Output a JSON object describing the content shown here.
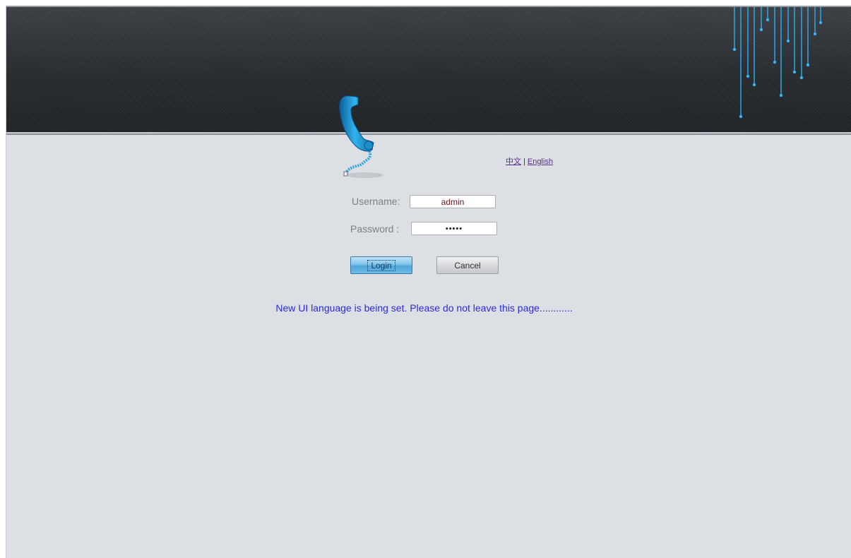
{
  "language_switch": {
    "chinese": "中文",
    "separator": "|",
    "english": "English"
  },
  "login_form": {
    "username_label": "Username:",
    "username_value": "admin",
    "password_label": "Password :",
    "password_value": "•••••",
    "login_button": "Login",
    "cancel_button": "Cancel"
  },
  "status_message": "New UI language is being set. Please do not leave this page............",
  "icons": {
    "logo": "telephone-handset-icon",
    "banner_decoration": "light-lines-decoration"
  },
  "colors": {
    "banner": "#2a2d31",
    "background": "#dcdfe4",
    "accent_blue": "#2a9fd8",
    "status_text": "#2b2bd6",
    "link": "#5b2c8a"
  }
}
